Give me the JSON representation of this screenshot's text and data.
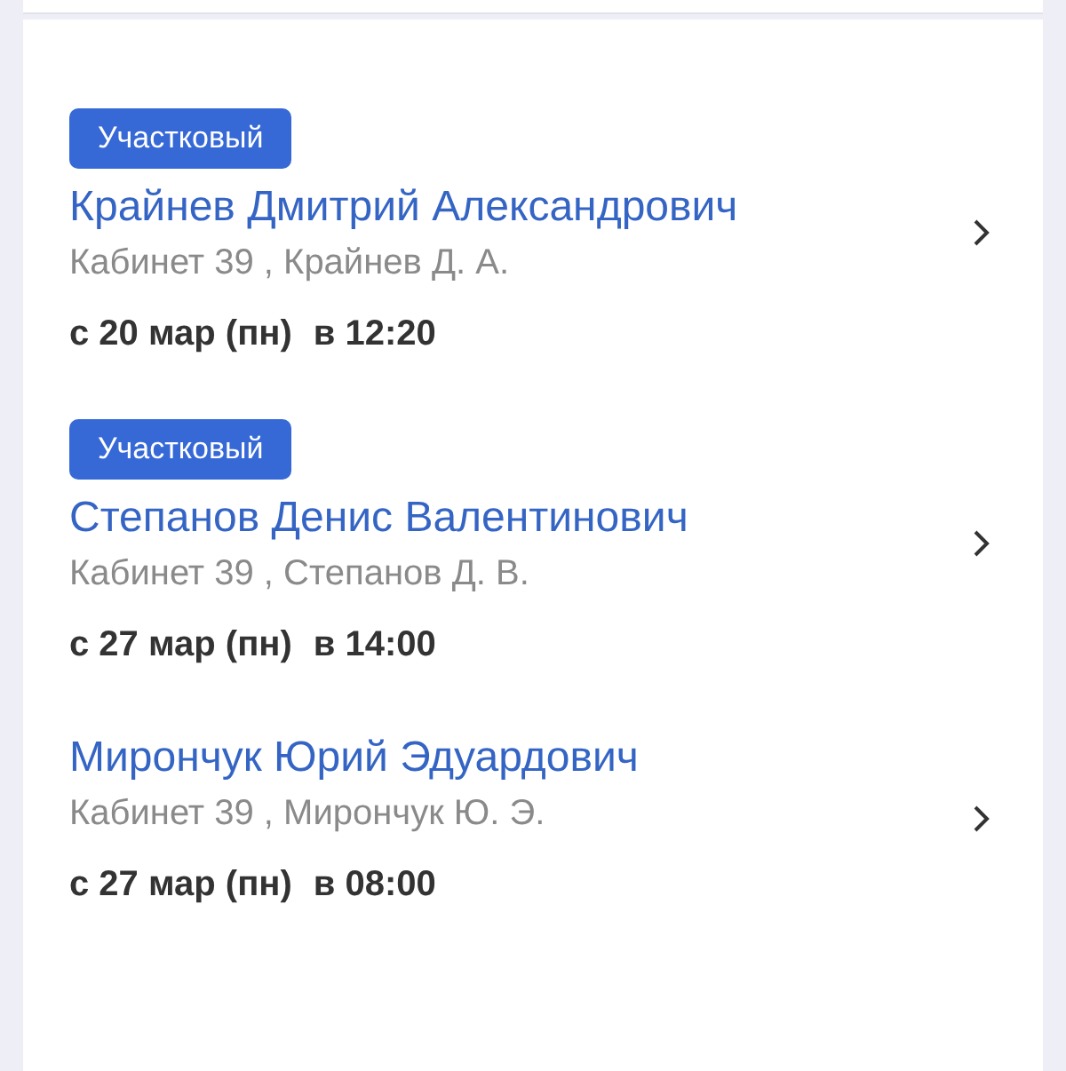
{
  "doctors": [
    {
      "badge": "Участковый",
      "name": "Крайнев Дмитрий Александрович",
      "office": "Кабинет 39 , Крайнев Д. А.",
      "date": "с 20 мар (пн)",
      "time": "в 12:20"
    },
    {
      "badge": "Участковый",
      "name": "Степанов Денис Валентинович",
      "office": "Кабинет 39 , Степанов Д. В.",
      "date": "с 27 мар (пн)",
      "time": "в 14:00"
    },
    {
      "name": "Мирончук Юрий Эдуардович",
      "office": "Кабинет 39 , Мирончук Ю. Э.",
      "date": "с 27 мар (пн)",
      "time": "в 08:00"
    }
  ]
}
